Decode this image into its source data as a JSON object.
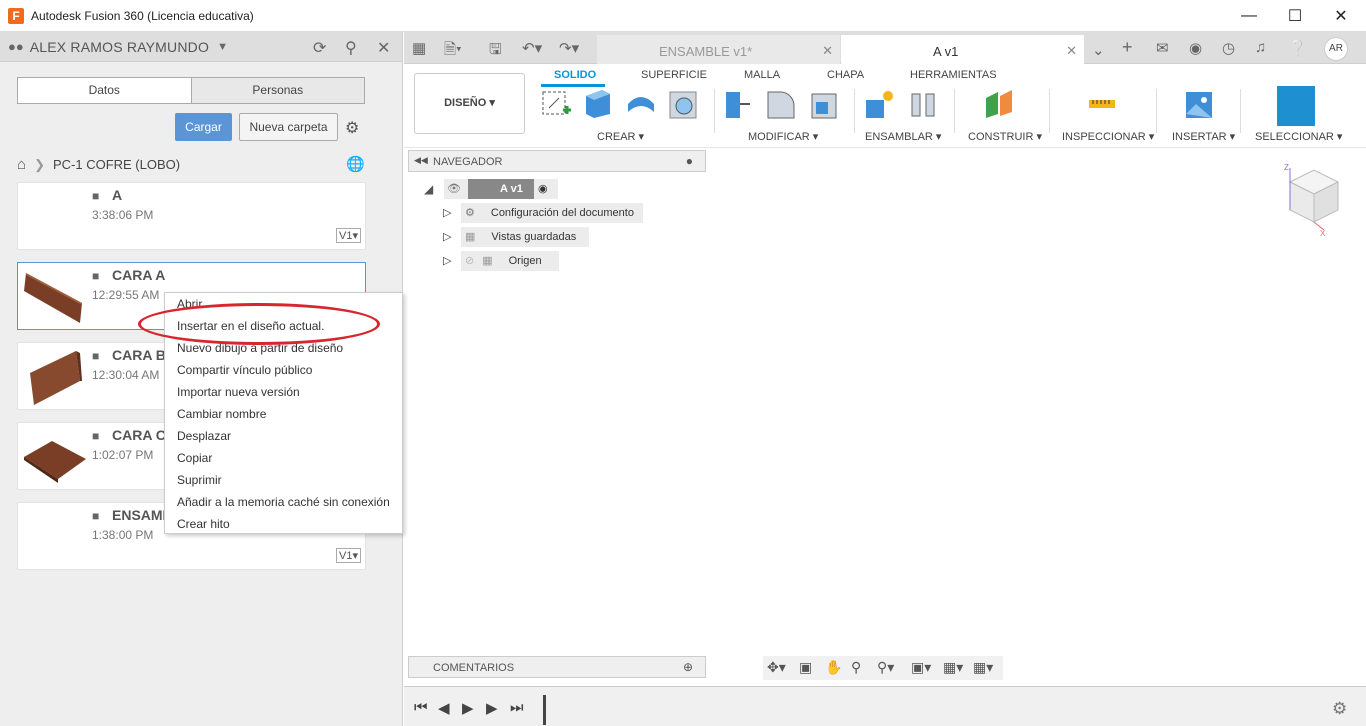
{
  "window": {
    "title": "Autodesk Fusion 360 (Licencia educativa)",
    "app_letter": "F"
  },
  "left": {
    "user": "ALEX RAMOS RAYMUNDO",
    "tabs": [
      "Datos",
      "Personas"
    ],
    "upload": "Cargar",
    "new_folder": "Nueva carpeta",
    "folder": "PC-1 COFRE (LOBO)",
    "cards": [
      {
        "name": "A",
        "time": "3:38:06 PM",
        "version": "V1▾"
      },
      {
        "name": "CARA A",
        "time": "12:29:55 AM"
      },
      {
        "name": "CARA B",
        "time": "12:30:04 AM"
      },
      {
        "name": "CARA C",
        "time": "1:02:07 PM"
      },
      {
        "name": "ENSAMB",
        "time": "1:38:00 PM",
        "version": "V1▾"
      }
    ]
  },
  "context_menu": [
    "Abrir",
    "Insertar en el diseño actual.",
    "Nuevo dibujo a partir de diseño",
    "Compartir vínculo público",
    "Importar nueva versión",
    "Cambiar nombre",
    "Desplazar",
    "Copiar",
    "Suprimir",
    "Añadir a la memoria caché sin conexión",
    "Crear hito"
  ],
  "tabs": {
    "tab1": "ENSAMBLE v1*",
    "tab2": "A v1",
    "avatar": "AR"
  },
  "toolbar": {
    "workspace": "DISEÑO ▾",
    "tabs": [
      "SOLIDO",
      "SUPERFICIE",
      "MALLA",
      "CHAPA",
      "HERRAMIENTAS"
    ],
    "groups": [
      "CREAR ▾",
      "MODIFICAR ▾",
      "ENSAMBLAR ▾",
      "CONSTRUIR ▾",
      "INSPECCIONAR ▾",
      "INSERTAR ▾",
      "SELECCIONAR ▾"
    ]
  },
  "browser": {
    "title": "NAVEGADOR",
    "root": "A v1",
    "items": [
      "Configuración del documento",
      "Vistas guardadas",
      "Origen"
    ],
    "comments": "COMENTARIOS"
  },
  "viewcube": {
    "z": "Z",
    "x": "X"
  }
}
